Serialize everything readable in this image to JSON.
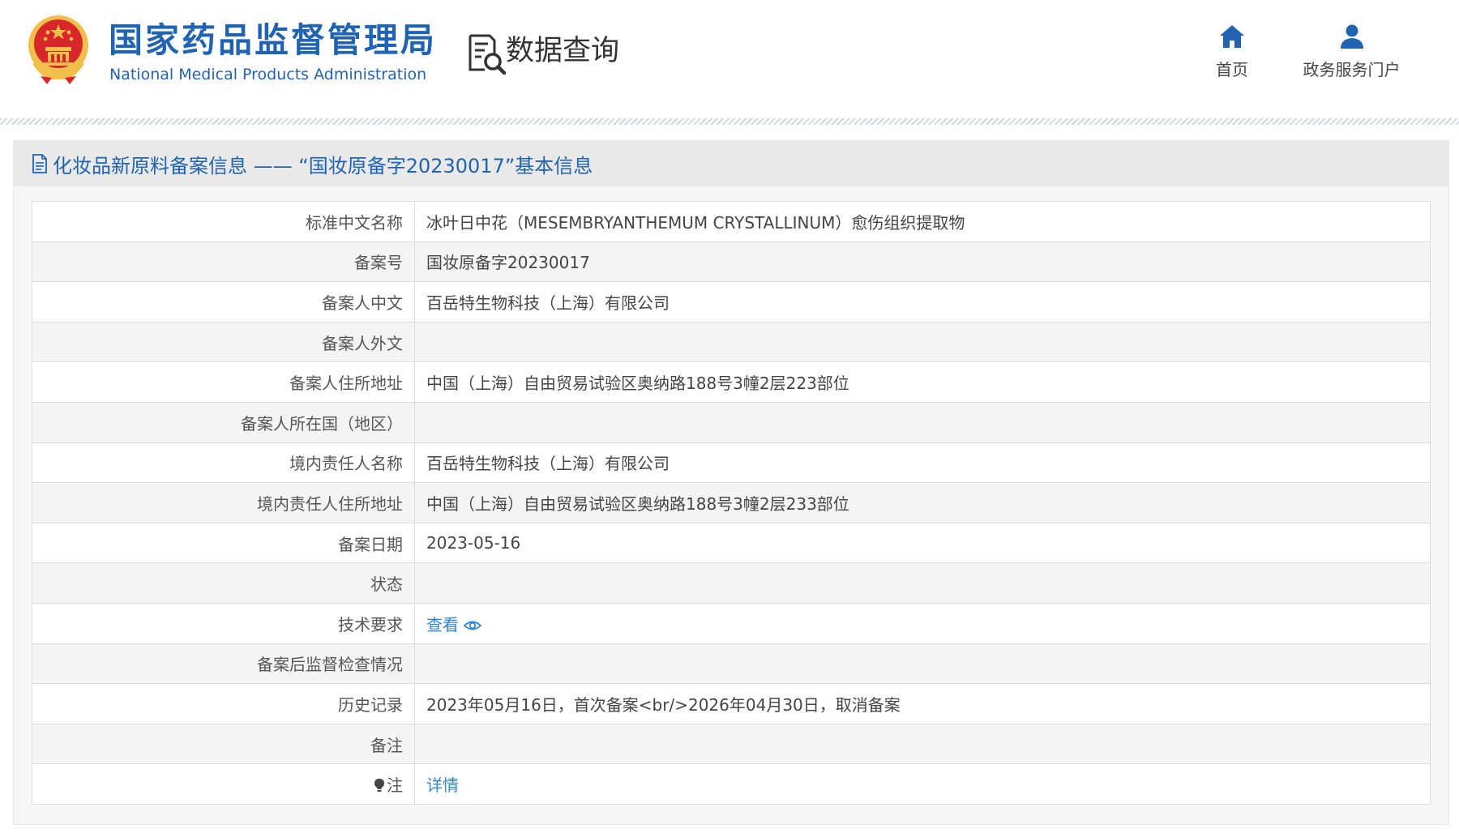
{
  "header": {
    "brand_cn": "国家药品监督管理局",
    "brand_en": "National Medical Products Administration",
    "query_title": "数据查询",
    "nav": [
      {
        "label": "首页",
        "icon": "home-icon"
      },
      {
        "label": "政务服务门户",
        "icon": "user-icon"
      }
    ]
  },
  "panel": {
    "title": "化妆品新原料备案信息 —— “国妆原备字20230017”基本信息",
    "icon": "document-icon"
  },
  "rows": [
    {
      "label": "标准中文名称",
      "value": "冰叶日中花（MESEMBRYANTHEMUM CRYSTALLINUM）愈伤组织提取物"
    },
    {
      "label": "备案号",
      "value": "国妆原备字20230017"
    },
    {
      "label": "备案人中文",
      "value": "百岳特生物科技（上海）有限公司"
    },
    {
      "label": "备案人外文",
      "value": ""
    },
    {
      "label": "备案人住所地址",
      "value": "中国（上海）自由贸易试验区奥纳路188号3幢2层223部位"
    },
    {
      "label": "备案人所在国（地区）",
      "value": ""
    },
    {
      "label": "境内责任人名称",
      "value": "百岳特生物科技（上海）有限公司"
    },
    {
      "label": "境内责任人住所地址",
      "value": "中国（上海）自由贸易试验区奥纳路188号3幢2层233部位"
    },
    {
      "label": "备案日期",
      "value": "2023-05-16"
    },
    {
      "label": "状态",
      "value": ""
    },
    {
      "label": "技术要求",
      "value": "查看",
      "icon": "eye-icon"
    },
    {
      "label": "备案后监督检查情况",
      "value": ""
    },
    {
      "label": "历史记录",
      "value": "2023年05月16日，首次备案<br/>2026年04月30日，取消备案"
    },
    {
      "label": "备注",
      "value": ""
    },
    {
      "label": "注",
      "value": "详情",
      "icon": "lightbulb-icon"
    }
  ],
  "colors": {
    "brand_blue": "#1f63b2",
    "link_blue": "#2f86d4",
    "emblem_red": "#d8262a",
    "emblem_gold": "#f2c04a"
  }
}
